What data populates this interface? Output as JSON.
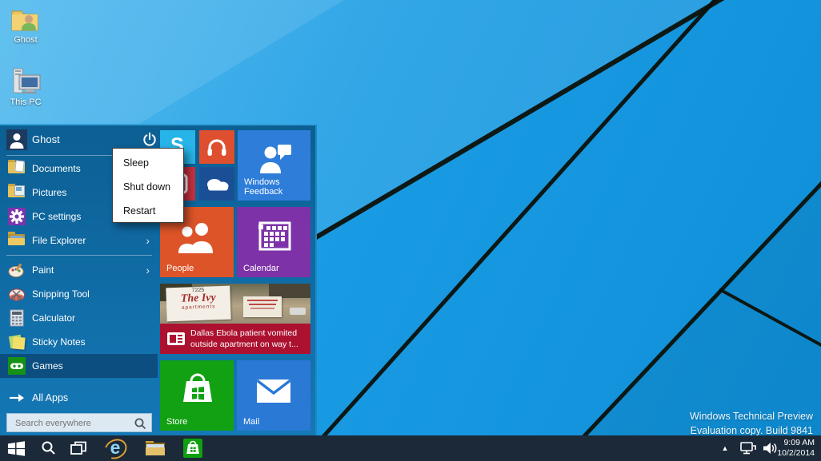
{
  "desktop": {
    "icons": [
      {
        "label": "Ghost"
      },
      {
        "label": "This PC"
      }
    ]
  },
  "start_menu": {
    "user_name": "Ghost",
    "power_menu": {
      "items": [
        {
          "label": "Sleep"
        },
        {
          "label": "Shut down"
        },
        {
          "label": "Restart"
        }
      ]
    },
    "nav_items": [
      {
        "label": "Documents"
      },
      {
        "label": "Pictures"
      },
      {
        "label": "PC settings"
      },
      {
        "label": "File Explorer",
        "has_submenu": true
      },
      {
        "label": "Paint",
        "has_submenu": true
      },
      {
        "label": "Snipping Tool"
      },
      {
        "label": "Calculator"
      },
      {
        "label": "Sticky Notes"
      },
      {
        "label": "Games",
        "selected": true
      }
    ],
    "all_apps_label": "All Apps",
    "search_placeholder": "Search everywhere",
    "tiles": {
      "skype": {
        "label": ""
      },
      "music": {
        "label": ""
      },
      "windows_feedback": {
        "label": "Windows Feedback"
      },
      "photos": {
        "label": ""
      },
      "onedrive": {
        "label": ""
      },
      "people": {
        "label": "People"
      },
      "calendar": {
        "label": "Calendar"
      },
      "news": {
        "headline_line1": "Dallas Ebola patient vomited",
        "headline_line2": "outside apartment on way t...",
        "photo_sign": {
          "line1": "7225",
          "line2": "The Ivy",
          "line3": "apartments"
        }
      },
      "store": {
        "label": "Store"
      },
      "mail": {
        "label": "Mail"
      }
    }
  },
  "taskbar": {
    "icons": [
      "start",
      "search",
      "task-view",
      "internet-explorer",
      "file-explorer",
      "store"
    ]
  },
  "tray": {
    "icons": [
      "hidden-icons-chevron",
      "network",
      "volume"
    ],
    "time": "9:09 AM",
    "date": "10/2/2014"
  },
  "watermark": {
    "line1": "Windows Technical Preview",
    "line2": "Evaluation copy. Build 9841"
  },
  "colors": {
    "wallpaper_base": "#1a9ce4",
    "start_menu_bg": "#0e69a3",
    "selected_row": "#0b4e7f",
    "tile_skype": "#27b4e8",
    "tile_music": "#dd4f2e",
    "tile_feedback": "#2e7dd9",
    "tile_photos": "#c5313f",
    "tile_onedrive": "#1a4f96",
    "tile_people": "#dd5429",
    "tile_calendar": "#7d32a8",
    "tile_news_banner": "#ac1230",
    "tile_store": "#12a112",
    "tile_mail": "#2a79d4",
    "taskbar_bg": "#1b2939"
  }
}
